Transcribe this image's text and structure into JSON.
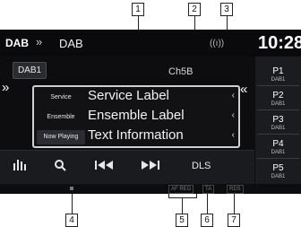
{
  "callouts": {
    "top": [
      "1",
      "2",
      "3"
    ],
    "bottom": [
      "4",
      "5",
      "6",
      "7"
    ]
  },
  "header": {
    "source_logo": "DAB",
    "breadcrumb_sep": "»",
    "source_name": "DAB",
    "signal_icon": "((ı))",
    "clock": "10:28"
  },
  "band_button": "DAB1",
  "channel": "Ch5B",
  "nav": {
    "left_chevron": "»",
    "right_chevron": "«"
  },
  "info_rows": [
    {
      "label": "Service",
      "value": "Service Label",
      "arrow": "‹"
    },
    {
      "label": "Ensemble",
      "value": "Ensemble Label",
      "arrow": "‹"
    },
    {
      "label": "Now Playing",
      "value": "Text Information",
      "arrow": "‹"
    }
  ],
  "presets": [
    {
      "num": "P1",
      "band": "DAB1"
    },
    {
      "num": "P2",
      "band": "DAB1"
    },
    {
      "num": "P3",
      "band": "DAB1"
    },
    {
      "num": "P4",
      "band": "DAB1"
    },
    {
      "num": "P5",
      "band": "DAB1"
    }
  ],
  "controls": {
    "eq_icon": "equalizer-icon",
    "search_icon": "search-icon",
    "prev_icon": "previous-track-icon",
    "next_icon": "next-track-icon",
    "dls_label": "DLS"
  },
  "status": {
    "af_reg": "AF REG",
    "ta": "TA",
    "rds": "RDS"
  },
  "colors": {
    "screen_bg": "#0d0d0f",
    "frame": "#cfcfd4",
    "preset_bg": "#1b1c20"
  }
}
